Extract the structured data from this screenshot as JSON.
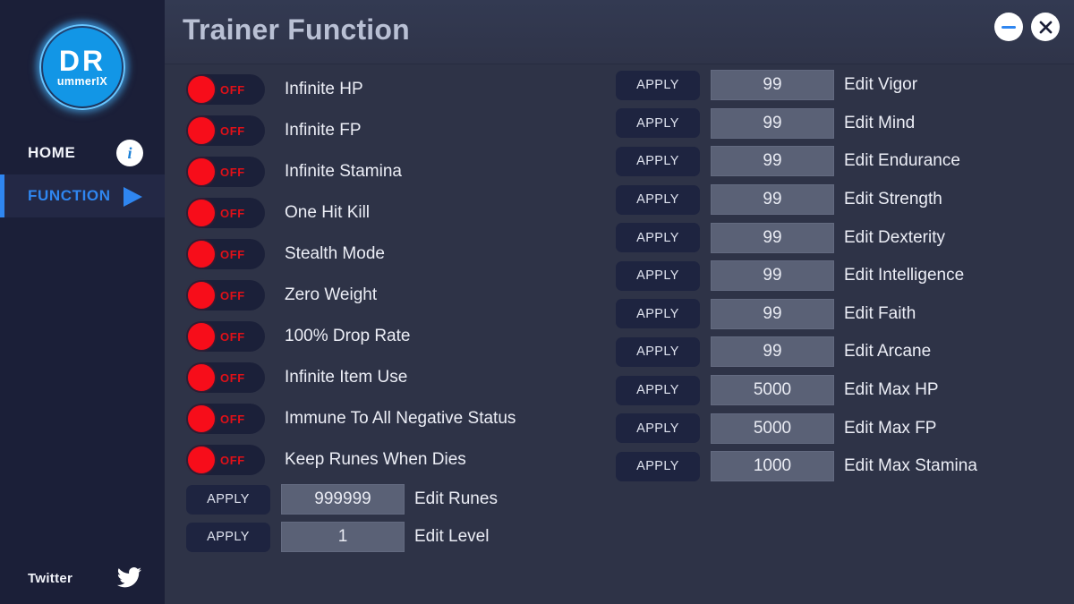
{
  "window": {
    "title": "Trainer Function",
    "minimize_icon": "minimize-icon",
    "close_icon": "close-icon",
    "close_glyph": "✕"
  },
  "sidebar": {
    "logo": {
      "main": "DR",
      "sub": "ummerIX",
      "color": "#1296e6"
    },
    "nav": [
      {
        "label": "HOME",
        "icon": "info-icon",
        "icon_glyph": "i",
        "active": false
      },
      {
        "label": "FUNCTION",
        "icon": "play-triangle-icon",
        "active": true
      }
    ],
    "footer": {
      "label": "Twitter",
      "icon": "twitter-bird-icon"
    },
    "accent_color": "#2f86f0",
    "background": "#1b1f38"
  },
  "toggles": [
    {
      "label": "Infinite HP",
      "state": "OFF"
    },
    {
      "label": "Infinite FP",
      "state": "OFF"
    },
    {
      "label": "Infinite Stamina",
      "state": "OFF"
    },
    {
      "label": "One Hit Kill",
      "state": "OFF"
    },
    {
      "label": "Stealth Mode",
      "state": "OFF"
    },
    {
      "label": "Zero Weight",
      "state": "OFF"
    },
    {
      "label": "100% Drop Rate",
      "state": "OFF"
    },
    {
      "label": "Infinite Item Use",
      "state": "OFF"
    },
    {
      "label": "Immune To All Negative Status",
      "state": "OFF"
    },
    {
      "label": "Keep Runes When Dies",
      "state": "OFF"
    }
  ],
  "left_fields": [
    {
      "button": "APPLY",
      "value": "999999",
      "label": "Edit Runes"
    },
    {
      "button": "APPLY",
      "value": "1",
      "label": "Edit Level"
    }
  ],
  "right_fields": [
    {
      "button": "APPLY",
      "value": "99",
      "label": "Edit Vigor"
    },
    {
      "button": "APPLY",
      "value": "99",
      "label": "Edit Mind"
    },
    {
      "button": "APPLY",
      "value": "99",
      "label": "Edit Endurance"
    },
    {
      "button": "APPLY",
      "value": "99",
      "label": "Edit Strength"
    },
    {
      "button": "APPLY",
      "value": "99",
      "label": "Edit Dexterity"
    },
    {
      "button": "APPLY",
      "value": "99",
      "label": "Edit Intelligence"
    },
    {
      "button": "APPLY",
      "value": "99",
      "label": "Edit Faith"
    },
    {
      "button": "APPLY",
      "value": "99",
      "label": "Edit Arcane"
    },
    {
      "button": "APPLY",
      "value": "5000",
      "label": "Edit Max HP"
    },
    {
      "button": "APPLY",
      "value": "5000",
      "label": "Edit Max FP"
    },
    {
      "button": "APPLY",
      "value": "1000",
      "label": "Edit Max Stamina"
    }
  ],
  "colors": {
    "toggle_off_red": "#f70d1a",
    "field_background": "#5a6176",
    "main_background": "#2e3347",
    "titlebar_background": "#2f3449"
  }
}
